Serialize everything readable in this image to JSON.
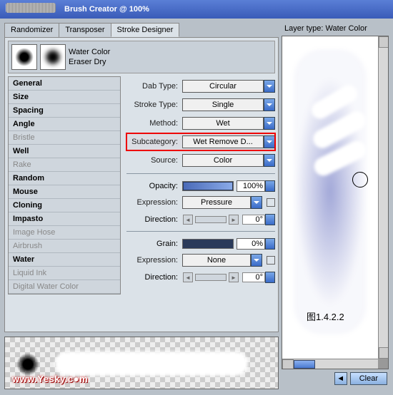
{
  "window": {
    "title": "Brush Creator @ 100%"
  },
  "tabs": {
    "randomizer": "Randomizer",
    "transposer": "Transposer",
    "stroke_designer": "Stroke Designer"
  },
  "brush": {
    "name1": "Water Color",
    "name2": "Eraser Dry"
  },
  "categories": [
    {
      "label": "General",
      "style": "bold"
    },
    {
      "label": "Size",
      "style": "bold"
    },
    {
      "label": "Spacing",
      "style": "bold"
    },
    {
      "label": "Angle",
      "style": "bold"
    },
    {
      "label": "Bristle",
      "style": "dim"
    },
    {
      "label": "Well",
      "style": "bold"
    },
    {
      "label": "Rake",
      "style": "dim"
    },
    {
      "label": "Random",
      "style": "bold"
    },
    {
      "label": "Mouse",
      "style": "bold"
    },
    {
      "label": "Cloning",
      "style": "bold"
    },
    {
      "label": "Impasto",
      "style": "bold"
    },
    {
      "label": "Image Hose",
      "style": "dim"
    },
    {
      "label": "Airbrush",
      "style": "dim"
    },
    {
      "label": "Water",
      "style": "bold"
    },
    {
      "label": "Liquid Ink",
      "style": "dim"
    },
    {
      "label": "Digital Water Color",
      "style": "dim"
    }
  ],
  "props": {
    "dab_type": {
      "label": "Dab Type:",
      "value": "Circular"
    },
    "stroke_type": {
      "label": "Stroke Type:",
      "value": "Single"
    },
    "method": {
      "label": "Method:",
      "value": "Wet"
    },
    "subcategory": {
      "label": "Subcategory:",
      "value": "Wet Remove D..."
    },
    "source": {
      "label": "Source:",
      "value": "Color"
    },
    "opacity": {
      "label": "Opacity:",
      "value": "100%"
    },
    "expression1": {
      "label": "Expression:",
      "value": "Pressure"
    },
    "direction1": {
      "label": "Direction:",
      "value": "0°"
    },
    "grain": {
      "label": "Grain:",
      "value": "0%"
    },
    "expression2": {
      "label": "Expression:",
      "value": "None"
    },
    "direction2": {
      "label": "Direction:",
      "value": "0°"
    }
  },
  "right": {
    "layer_type": "Layer type: Water Color",
    "caption": "图1.4.2.2",
    "clear": "Clear"
  },
  "watermark": "www.Yesky.c●m"
}
